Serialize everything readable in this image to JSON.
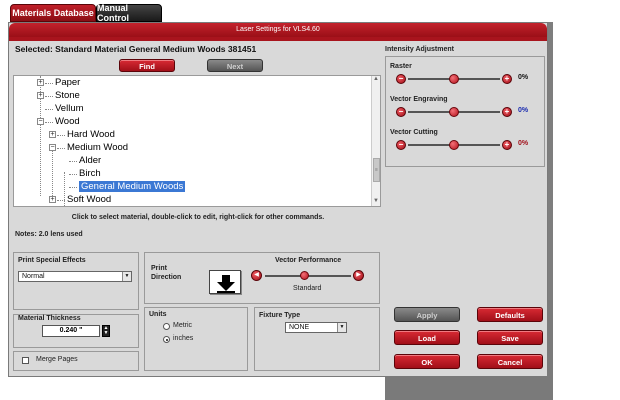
{
  "tabs": [
    {
      "label": "Materials Database",
      "active": true
    },
    {
      "label": "Manual Control",
      "active": false
    }
  ],
  "window": {
    "title": "Laser Settings for VLS4.60"
  },
  "selected_label": "Selected: Standard Material General Medium Woods 381451",
  "buttons": {
    "find": "Find",
    "next": "Next",
    "apply": "Apply",
    "defaults": "Defaults",
    "load": "Load",
    "save": "Save",
    "ok": "OK",
    "cancel": "Cancel"
  },
  "tree": {
    "items": [
      {
        "label": "Paper",
        "level": 0,
        "expander": "+"
      },
      {
        "label": "Stone",
        "level": 0,
        "expander": "+"
      },
      {
        "label": "Vellum",
        "level": 0,
        "expander": ""
      },
      {
        "label": "Wood",
        "level": 0,
        "expander": "-"
      },
      {
        "label": "Hard Wood",
        "level": 1,
        "expander": "+"
      },
      {
        "label": "Medium Wood",
        "level": 1,
        "expander": "-"
      },
      {
        "label": "Alder",
        "level": 2,
        "expander": ""
      },
      {
        "label": "Birch",
        "level": 2,
        "expander": ""
      },
      {
        "label": "General Medium Woods",
        "level": 2,
        "expander": "",
        "selected": true
      },
      {
        "label": "Soft Wood",
        "level": 1,
        "expander": "+"
      }
    ]
  },
  "hint": "Click to select material, double-click to edit, right-click for other commands.",
  "notes": "Notes: 2.0 lens used",
  "intensity": {
    "title": "Intensity Adjustment",
    "sliders": [
      {
        "label": "Raster",
        "value": "0%",
        "value_color": "#111111",
        "level": 0.5
      },
      {
        "label": "Vector Engraving",
        "value": "0%",
        "value_color": "#1a2bb0",
        "level": 0.5
      },
      {
        "label": "Vector Cutting",
        "value": "0%",
        "value_color": "#a1101a",
        "level": 0.5
      }
    ]
  },
  "print_effects": {
    "label": "Print Special Effects",
    "value": "Normal"
  },
  "thickness": {
    "label": "Material Thickness",
    "value": "0.240 \""
  },
  "merge_pages": {
    "label": "Merge Pages",
    "checked": false
  },
  "print_direction": {
    "label_line1": "Print",
    "label_line2": "Direction",
    "icon": "down-arrow-icon"
  },
  "vector_performance": {
    "label": "Vector Performance",
    "value": "Standard",
    "level": 0.45
  },
  "units": {
    "label": "Units",
    "options": [
      {
        "label": "Metric",
        "selected": false
      },
      {
        "label": "inches",
        "selected": true
      }
    ]
  },
  "fixture": {
    "label": "Fixture Type",
    "value": "NONE"
  },
  "colors": {
    "accent_red": "#b3121c",
    "panel_gray": "#d9d9d9",
    "selection_blue": "#3b78d4"
  }
}
